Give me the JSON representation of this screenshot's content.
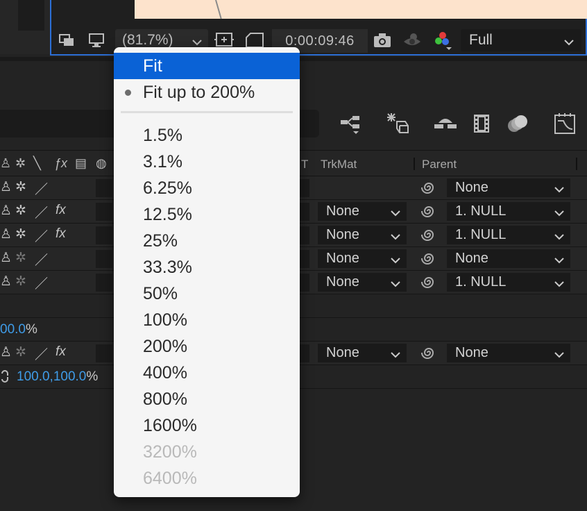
{
  "viewer": {
    "zoom_label": "(81.7%)",
    "timecode": "0:00:09:46",
    "resolution_label": "Full"
  },
  "menu": {
    "items": [
      {
        "label": "Fit",
        "state": "selected"
      },
      {
        "label": "Fit up to 200%",
        "state": "checked"
      },
      {
        "label": "1.5%",
        "state": "normal"
      },
      {
        "label": "3.1%",
        "state": "normal"
      },
      {
        "label": "6.25%",
        "state": "normal"
      },
      {
        "label": "12.5%",
        "state": "normal"
      },
      {
        "label": "25%",
        "state": "normal"
      },
      {
        "label": "33.3%",
        "state": "normal"
      },
      {
        "label": "50%",
        "state": "normal"
      },
      {
        "label": "100%",
        "state": "normal"
      },
      {
        "label": "200%",
        "state": "normal"
      },
      {
        "label": "400%",
        "state": "normal"
      },
      {
        "label": "800%",
        "state": "normal"
      },
      {
        "label": "1600%",
        "state": "normal"
      },
      {
        "label": "3200%",
        "state": "disabled"
      },
      {
        "label": "6400%",
        "state": "disabled"
      }
    ]
  },
  "timeline": {
    "columns": {
      "trkmat": "TrkMat",
      "trkmat_fragment": "T",
      "parent": "Parent"
    },
    "layers": [
      {
        "fx": "",
        "trkmat": "",
        "parent": "None"
      },
      {
        "fx": "fx",
        "trkmat": "None",
        "parent": "1. NULL"
      },
      {
        "fx": "fx",
        "trkmat": "None",
        "parent": "1. NULL"
      },
      {
        "fx": "",
        "trkmat": "None",
        "parent": "None"
      },
      {
        "fx": "",
        "trkmat": "None",
        "parent": "1. NULL"
      }
    ],
    "prop_row_1": {
      "value": "00.0",
      "unit": "%"
    },
    "extra_layer": {
      "fx": "fx",
      "trkmat": "None",
      "parent": "None"
    },
    "scale_row": {
      "value_x": "100.0",
      "comma": ",",
      "value_y": "100.0",
      "unit": "%"
    }
  },
  "colors": {
    "accent_blue": "#0a62d6",
    "value_blue": "#3f9ce8",
    "viewer_border": "#2c6fd6",
    "canvas": "#fde3cc"
  }
}
